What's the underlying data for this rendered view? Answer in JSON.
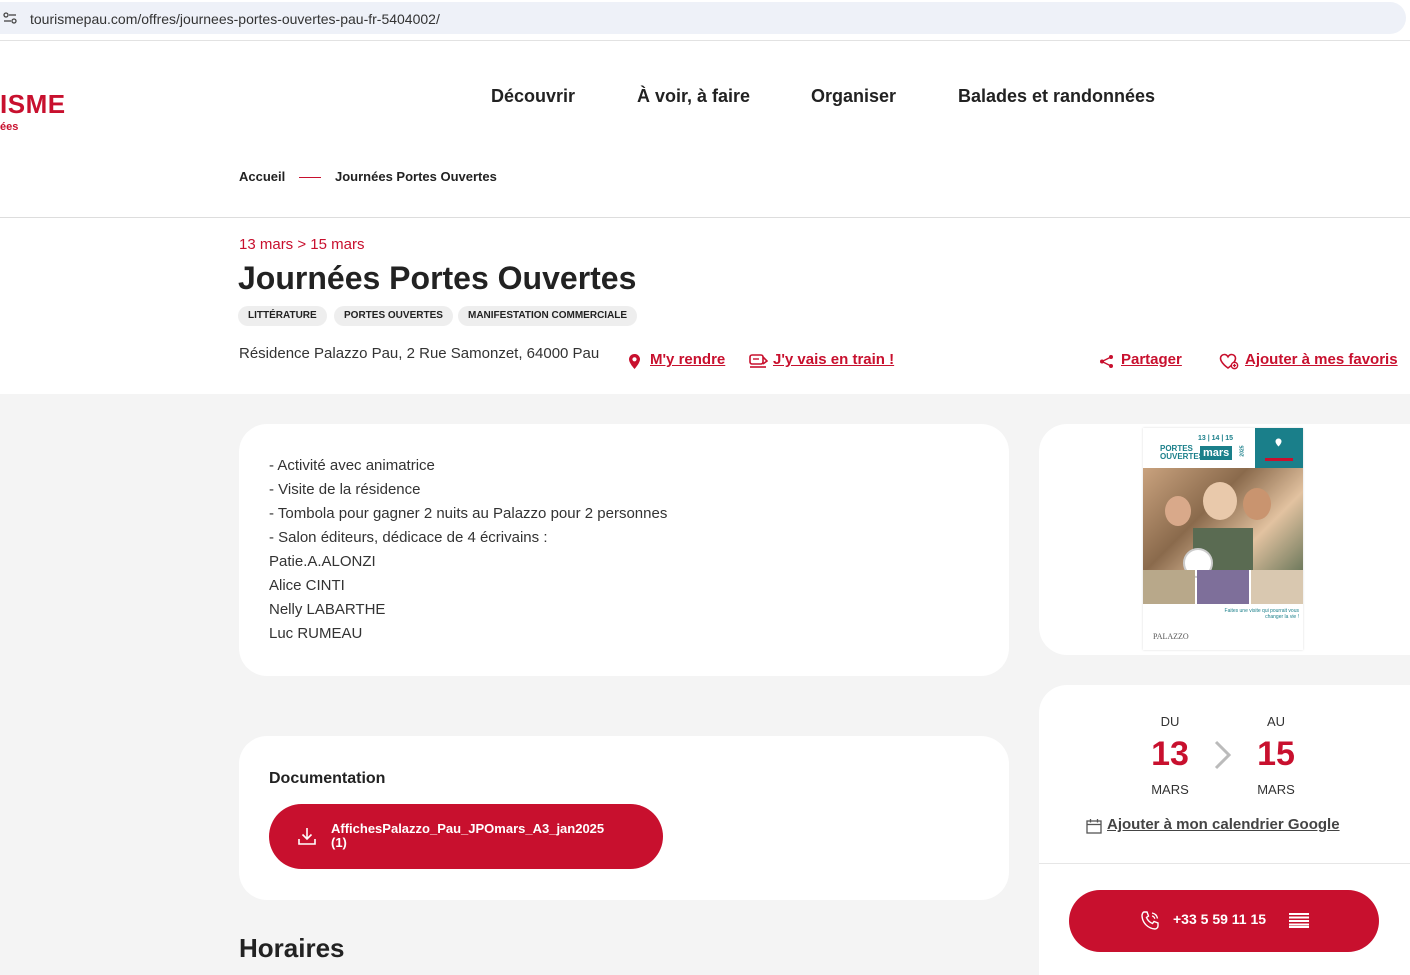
{
  "browser": {
    "url": "tourismepau.com/offres/journees-portes-ouvertes-pau-fr-5404002/"
  },
  "header": {
    "logo_main": "ISME",
    "logo_sub": "ées",
    "nav": [
      "Découvrir",
      "À voir, à faire",
      "Organiser",
      "Balades et randonnées"
    ]
  },
  "breadcrumb": {
    "home": "Accueil",
    "current": "Journées Portes Ouvertes"
  },
  "event": {
    "dates": "13 mars > 15 mars",
    "title": "Journées Portes Ouvertes",
    "tags": [
      "LITTÉRATURE",
      "PORTES OUVERTES",
      "MANIFESTATION COMMERCIALE"
    ],
    "address": "Résidence Palazzo Pau, 2 Rue Samonzet, 64000 Pau",
    "actions": {
      "directions": "M'y rendre",
      "train": "J'y vais en train !",
      "share": "Partager",
      "favorite": "Ajouter à mes favoris"
    }
  },
  "description": [
    "- Activité avec animatrice",
    "- Visite de la résidence",
    "- Tombola pour gagner 2 nuits au Palazzo pour 2 personnes",
    "- Salon éditeurs, dédicace de 4 écrivains :",
    "Patie.A.ALONZI",
    "Alice CINTI",
    "Nelly LABARTHE",
    "Luc RUMEAU"
  ],
  "documentation": {
    "title": "Documentation",
    "file_line1": "AffichesPalazzo_Pau_JPOmars_A3_jan2025",
    "file_line2": "(1)"
  },
  "schedule": {
    "title": "Horaires"
  },
  "poster": {
    "days": "13 | 14 | 15",
    "portes": "PORTES",
    "ouvertes": "OUVERTES",
    "month": "mars",
    "year": "2025",
    "tagline": "Faites une visite qui pourrait vous changer la vie !",
    "brand": "PALAZZO"
  },
  "date_card": {
    "from_label": "DU",
    "from_day": "13",
    "from_month": "MARS",
    "to_label": "AU",
    "to_day": "15",
    "to_month": "MARS",
    "gcal": "Ajouter à mon calendrier Google",
    "phone": "+33 5 59 11 15"
  },
  "colors": {
    "brand_red": "#c8102e",
    "page_bg": "#f4f4f4",
    "poster_teal": "#1a7f8a"
  }
}
